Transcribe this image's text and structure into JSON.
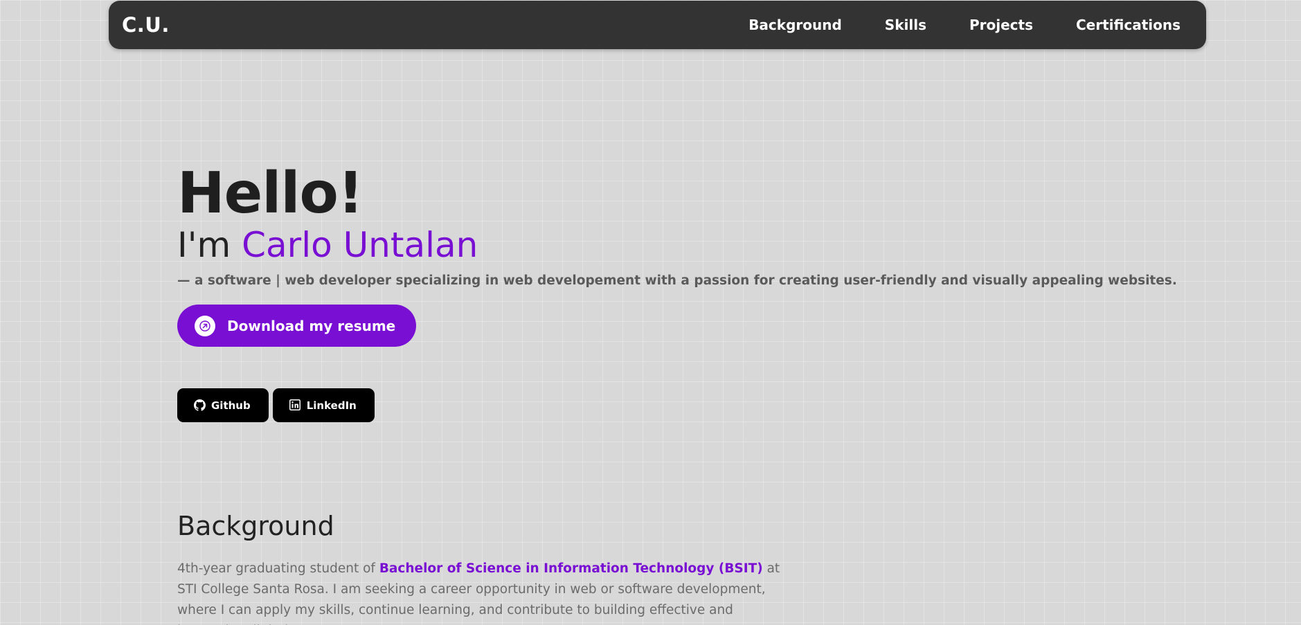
{
  "navbar": {
    "brand": "C.U.",
    "links": [
      {
        "label": "Background"
      },
      {
        "label": "Skills"
      },
      {
        "label": "Projects"
      },
      {
        "label": "Certifications"
      }
    ]
  },
  "hero": {
    "greeting": "Hello!",
    "intro_prefix": "I'm ",
    "name": "Carlo Untalan",
    "tagline": "— a software | web developer specializing in web developement with a passion for creating user-friendly and visually appealing websites.",
    "resume_button": {
      "label": "Download my resume",
      "icon": "arrow-up-right-icon"
    },
    "social": [
      {
        "label": "Github",
        "icon": "github-icon"
      },
      {
        "label": "LinkedIn",
        "icon": "linkedin-icon"
      }
    ]
  },
  "background": {
    "title": "Background",
    "body_before": "4th-year graduating student of ",
    "degree": "Bachelor of Science in Information Technology (BSIT)",
    "body_after": " at STI College Santa Rosa. I am seeking a career opportunity in web or software development, where I can apply my skills, continue learning, and contribute to building effective and innovative digital"
  },
  "colors": {
    "accent": "#7a0fd4",
    "navbar_bg": "#333333",
    "page_bg": "#d8d8d8",
    "social_bg": "#000000"
  }
}
